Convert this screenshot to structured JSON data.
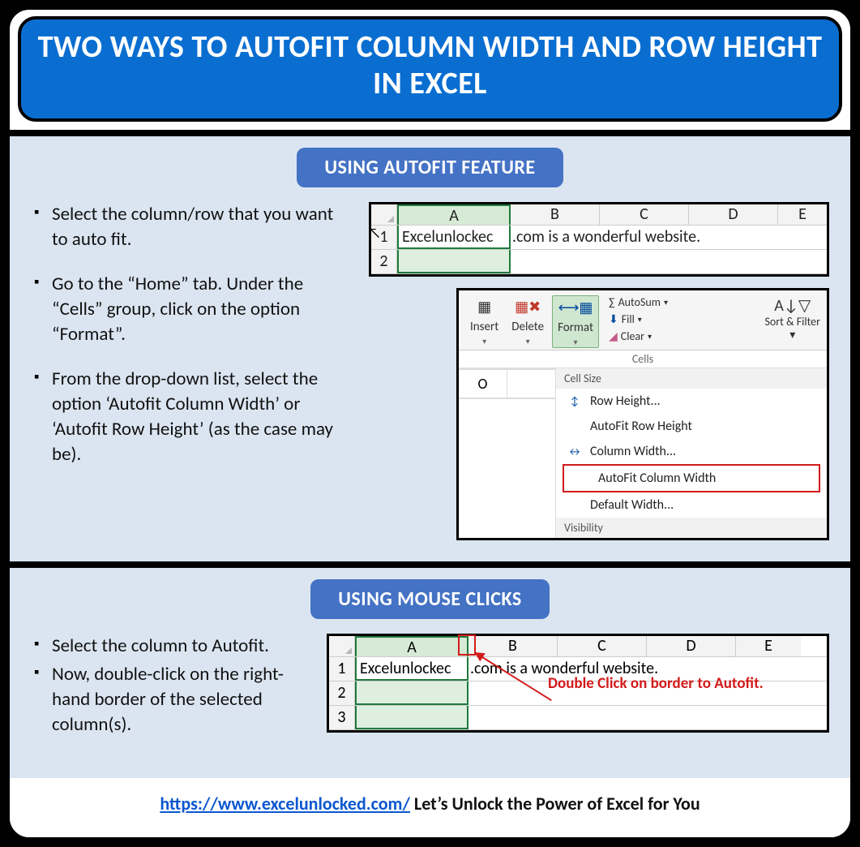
{
  "title": "TWO WAYS TO AUTOFIT COLUMN WIDTH AND ROW HEIGHT IN EXCEL",
  "section1": {
    "heading": "USING AUTOFIT FEATURE",
    "steps": [
      "Select the column/row that you want to auto fit.",
      "Go to the “Home” tab. Under the “Cells” group, click on the option “Format”.",
      "From the drop-down list, select the option ‘Autofit Column Width’ or ‘Autofit Row Height’ (as the case may be)."
    ],
    "sheet": {
      "columns": [
        "A",
        "B",
        "C",
        "D",
        "E"
      ],
      "rows": [
        "1",
        "2"
      ],
      "cellA1_left": "Excelunlockec",
      "cellA1_right": ".com is a wonderful website."
    },
    "ribbon": {
      "insert": "Insert",
      "delete": "Delete",
      "format": "Format",
      "cells_label": "Cells",
      "autosum": "AutoSum",
      "fill": "Fill",
      "clear": "Clear",
      "sortfilter": "Sort & Filter",
      "menu_header": "Cell Size",
      "items": {
        "row_height": "Row Height...",
        "autofit_row": "AutoFit Row Height",
        "col_width": "Column Width...",
        "autofit_col": "AutoFit Column Width",
        "default_w": "Default Width..."
      },
      "visibility": "Visibility",
      "sheet_row_label": "O"
    }
  },
  "section2": {
    "heading": "USING MOUSE CLICKS",
    "steps": [
      "Select the column to Autofit.",
      "Now, double-click on the right-hand border of the selected column(s)."
    ],
    "sheet": {
      "columns": [
        "A",
        "B",
        "C",
        "D",
        "E"
      ],
      "rows": [
        "1",
        "2",
        "3"
      ],
      "cellA1_left": "Excelunlockec",
      "cellA1_right": ".com is a wonderful website."
    },
    "annotation": "Double Click on border to Autofit."
  },
  "footer": {
    "url_text": "https://www.excelunlocked.com/",
    "tagline": " Let’s Unlock the Power of Excel for You"
  }
}
